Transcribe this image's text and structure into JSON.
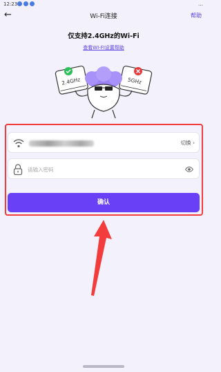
{
  "status": {
    "time": "12:23",
    "right": "…"
  },
  "header": {
    "title": "Wi-Fi连接",
    "help": "帮助",
    "back_icon": "arrow-left-icon"
  },
  "info": {
    "headline": "仅支持2.4GHz的Wi-Fi",
    "link": "查看WI-FI设置帮助"
  },
  "illustration": {
    "left_router": "2.4GHz",
    "right_router": "5GHz"
  },
  "form": {
    "wifi_icon": "wifi-icon",
    "switch_label": "切换 ›",
    "password_placeholder": "请输入密码",
    "password_value": "",
    "confirm_label": "确认"
  },
  "colors": {
    "accent": "#6a40f6",
    "link": "#5b3fe3",
    "highlight": "#f23b3b",
    "ok": "#2dbf5a",
    "error": "#e63b3b"
  }
}
